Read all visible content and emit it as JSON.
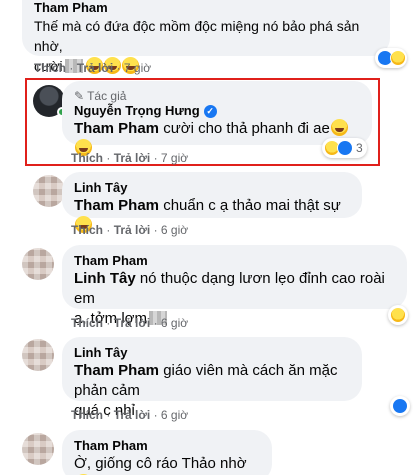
{
  "comments": [
    {
      "name": "Tham Pham",
      "text_prefix": "",
      "text": "Thế mà có đứa độc mồm độc miệng nó bảo phá sản nhờ,",
      "text2": "cười",
      "like_label": "Thích",
      "reply_label": "Trả lời",
      "time": "7 giờ"
    },
    {
      "author_tag": "Tác giả",
      "name": "Nguyễn Trọng Hưng",
      "mention": "Tham Pham",
      "text": "cười cho thả phanh đi ae",
      "like_label": "Thích",
      "reply_label": "Trả lời",
      "time": "7 giờ",
      "reaction_count": "3"
    },
    {
      "name": "Linh Tây",
      "mention": "Tham Pham",
      "text": "chuẩn c ạ thảo mai thật sự",
      "like_label": "Thích",
      "reply_label": "Trả lời",
      "time": "6 giờ"
    },
    {
      "name": "Tham Pham",
      "mention": "Linh Tây",
      "text": "nó thuộc dạng lươn lẹo đỉnh cao roài em",
      "text2": "ạ, tởm lợm",
      "like_label": "Thích",
      "reply_label": "Trả lời",
      "time": "6 giờ"
    },
    {
      "name": "Linh Tây",
      "mention": "Tham Pham",
      "text": "giáo viên mà cách ăn mặc phản cảm",
      "text2": "quá c nhỉ",
      "like_label": "Thích",
      "reply_label": "Trả lời",
      "time": "6 giờ"
    },
    {
      "name": "Tham Pham",
      "text": "Ờ, giống cô ráo Thảo nhờ"
    }
  ],
  "separator": "·",
  "colors": {
    "highlight": "#e0201b",
    "bubble": "#f0f2f5",
    "meta": "#65676b",
    "like": "#1877f2"
  }
}
